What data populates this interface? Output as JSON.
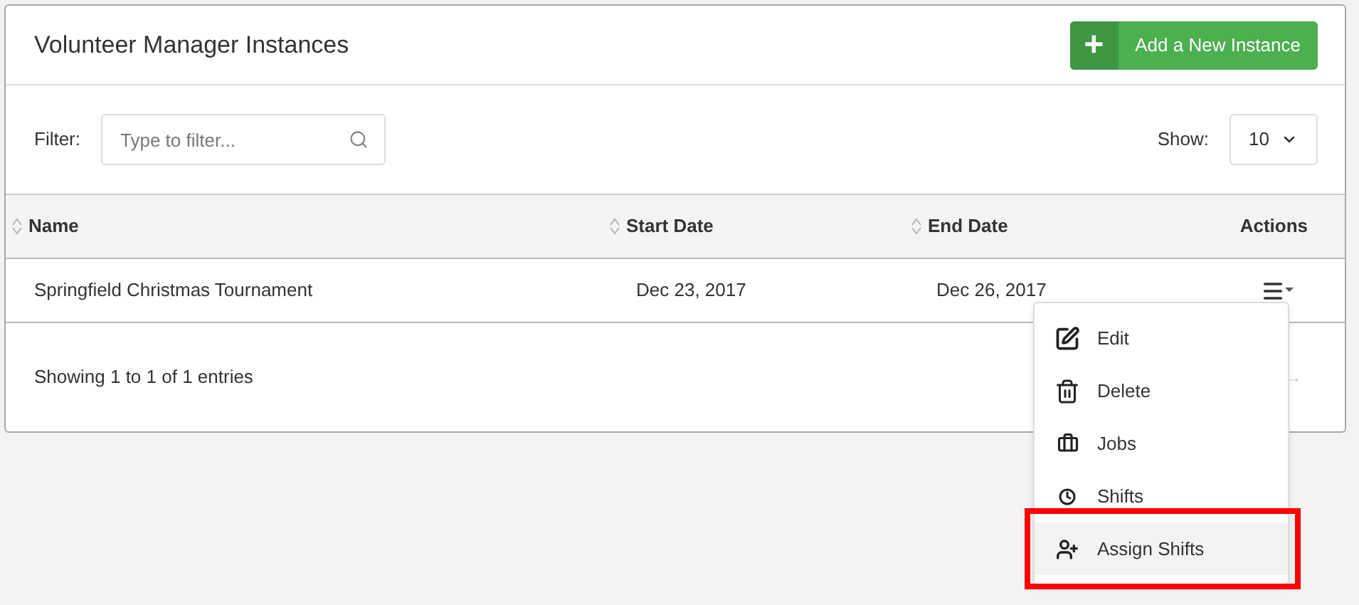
{
  "panel": {
    "title": "Volunteer Manager Instances",
    "add_button": {
      "icon": "+",
      "label": "Add a New Instance"
    }
  },
  "filter": {
    "label": "Filter:",
    "placeholder": "Type to filter..."
  },
  "show": {
    "label": "Show:",
    "value": "10"
  },
  "table": {
    "columns": [
      {
        "label": "Name",
        "sortable": true
      },
      {
        "label": "Start Date",
        "sortable": true
      },
      {
        "label": "End Date",
        "sortable": true
      },
      {
        "label": "Actions",
        "sortable": false
      }
    ],
    "rows": [
      {
        "cells": [
          "Springfield Christmas Tournament",
          "Dec 23, 2017",
          "Dec 26, 2017"
        ],
        "menu_open": true
      }
    ]
  },
  "footer": {
    "info": "Showing 1 to 1 of 1 entries",
    "next": "→"
  },
  "actions_menu": [
    {
      "kind": "edit",
      "label": "Edit",
      "selected": false,
      "annotated": false
    },
    {
      "kind": "delete",
      "label": "Delete",
      "selected": false,
      "annotated": false
    },
    {
      "kind": "jobs",
      "label": "Jobs",
      "selected": false,
      "annotated": false
    },
    {
      "kind": "shifts",
      "label": "Shifts",
      "selected": false,
      "annotated": false
    },
    {
      "kind": "assign",
      "label": "Assign Shifts",
      "selected": true,
      "annotated": true
    }
  ]
}
